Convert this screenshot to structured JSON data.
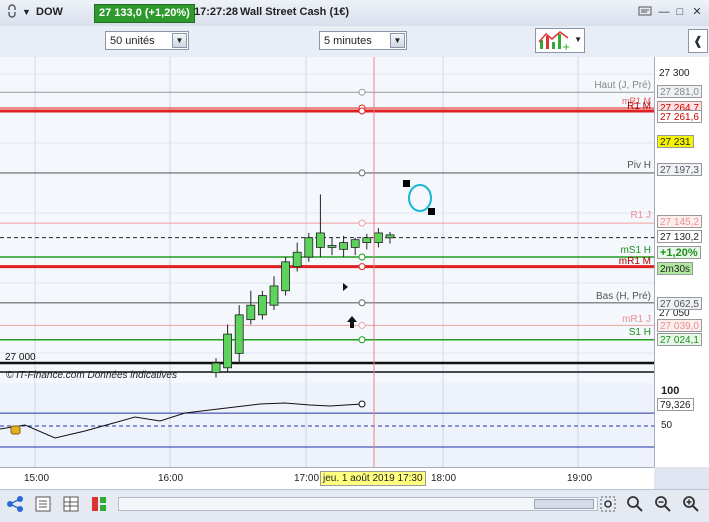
{
  "titlebar": {
    "symbol": "DOW",
    "price_badge": "27 133,0 (+1,20%)",
    "time": "17:27:28",
    "instrument": "Wall Street Cash (1€)"
  },
  "toolbar": {
    "units_select": "50 unités",
    "interval_select": "5 minutes"
  },
  "price_axis": {
    "ticks": [
      "27 300",
      "27 050",
      "27 000"
    ],
    "labels": [
      {
        "text": "27 281,0",
        "bg": "#eef1f5",
        "fg": "#888888"
      },
      {
        "text": "27 264,7",
        "bg": "#ffe0e0",
        "fg": "#cc0000"
      },
      {
        "text": "27 261,6",
        "bg": "#ffffff",
        "fg": "#cc0000"
      },
      {
        "text": "27 231",
        "bg": "#f5f500",
        "fg": "#222222"
      },
      {
        "text": "27 197,3",
        "bg": "#eef1f5",
        "fg": "#555555"
      },
      {
        "text": "27 145,2",
        "bg": "#ffeeee",
        "fg": "#e89090"
      },
      {
        "text": "27 130,2",
        "bg": "#ffffff",
        "fg": "#222222"
      },
      {
        "text": "+1,20%",
        "bg": "#e8f8e8",
        "fg": "#1e8e1e"
      },
      {
        "text": "2m30s",
        "bg": "#b0e8a0",
        "fg": "#222222"
      },
      {
        "text": "27 062,5",
        "bg": "#eef1f5",
        "fg": "#555555"
      },
      {
        "text": "27 039,0",
        "bg": "#ffeeee",
        "fg": "#e89090"
      },
      {
        "text": "27 024,1",
        "bg": "#e8f8e8",
        "fg": "#1e8e1e"
      }
    ]
  },
  "line_labels": {
    "haut": "Haut (J, Pré)",
    "mr1_m": "mR1 M",
    "r1_m": "R1 M",
    "piv_h": "Piv H",
    "r1_j": "R1 J",
    "ms1_h": "mS1 H",
    "mr1_m2": "mR1 M",
    "bas": "Bas (H, Pré)",
    "mr1_j": "mR1 J",
    "s1_h": "S1 H",
    "level_27000": "27 000"
  },
  "watermark": "© IT-Finance.com  Données indicatives",
  "oscillator": {
    "ticks": [
      "100",
      "50"
    ],
    "value_label": "79,326"
  },
  "time_axis": {
    "ticks": [
      "15:00",
      "16:00",
      "17:00",
      "18:00",
      "19:00"
    ],
    "cursor_label": "jeu. 1 août 2019 17:30"
  },
  "colors": {
    "price_badge": "#2e9a2e",
    "resistance": "#e02020",
    "support": "#1e9e1e",
    "candle_up": "#5dd35d",
    "cursor_label_bg": "#ffff80"
  },
  "chart_data": {
    "type": "candlestick",
    "interval": "5 minutes",
    "series": [
      {
        "o": 26990,
        "h": 27005,
        "l": 26985,
        "c": 27000
      },
      {
        "o": 26995,
        "h": 27040,
        "l": 26990,
        "c": 27030
      },
      {
        "o": 27010,
        "h": 27060,
        "l": 27000,
        "c": 27050
      },
      {
        "o": 27045,
        "h": 27075,
        "l": 27040,
        "c": 27060
      },
      {
        "o": 27050,
        "h": 27075,
        "l": 27045,
        "c": 27070
      },
      {
        "o": 27060,
        "h": 27090,
        "l": 27055,
        "c": 27080
      },
      {
        "o": 27075,
        "h": 27110,
        "l": 27070,
        "c": 27105
      },
      {
        "o": 27100,
        "h": 27125,
        "l": 27095,
        "c": 27115
      },
      {
        "o": 27110,
        "h": 27135,
        "l": 27105,
        "c": 27130
      },
      {
        "o": 27120,
        "h": 27175,
        "l": 27110,
        "c": 27135
      },
      {
        "o": 27120,
        "h": 27130,
        "l": 27112,
        "c": 27122
      },
      {
        "o": 27118,
        "h": 27132,
        "l": 27110,
        "c": 27125
      },
      {
        "o": 27120,
        "h": 27130,
        "l": 27112,
        "c": 27128
      },
      {
        "o": 27125,
        "h": 27134,
        "l": 27118,
        "c": 27130
      },
      {
        "o": 27125,
        "h": 27140,
        "l": 27120,
        "c": 27135
      },
      {
        "o": 27130,
        "h": 27136,
        "l": 27124,
        "c": 27133
      }
    ],
    "levels": [
      27281.0,
      27264.7,
      27261.6,
      27197.3,
      27145.2,
      27130.2,
      27110.0,
      27100.0,
      27062.5,
      27039.0,
      27024.1,
      27000.0
    ],
    "oscillator": {
      "name": "",
      "last": 79.326,
      "levels": [
        100,
        50
      ]
    }
  }
}
